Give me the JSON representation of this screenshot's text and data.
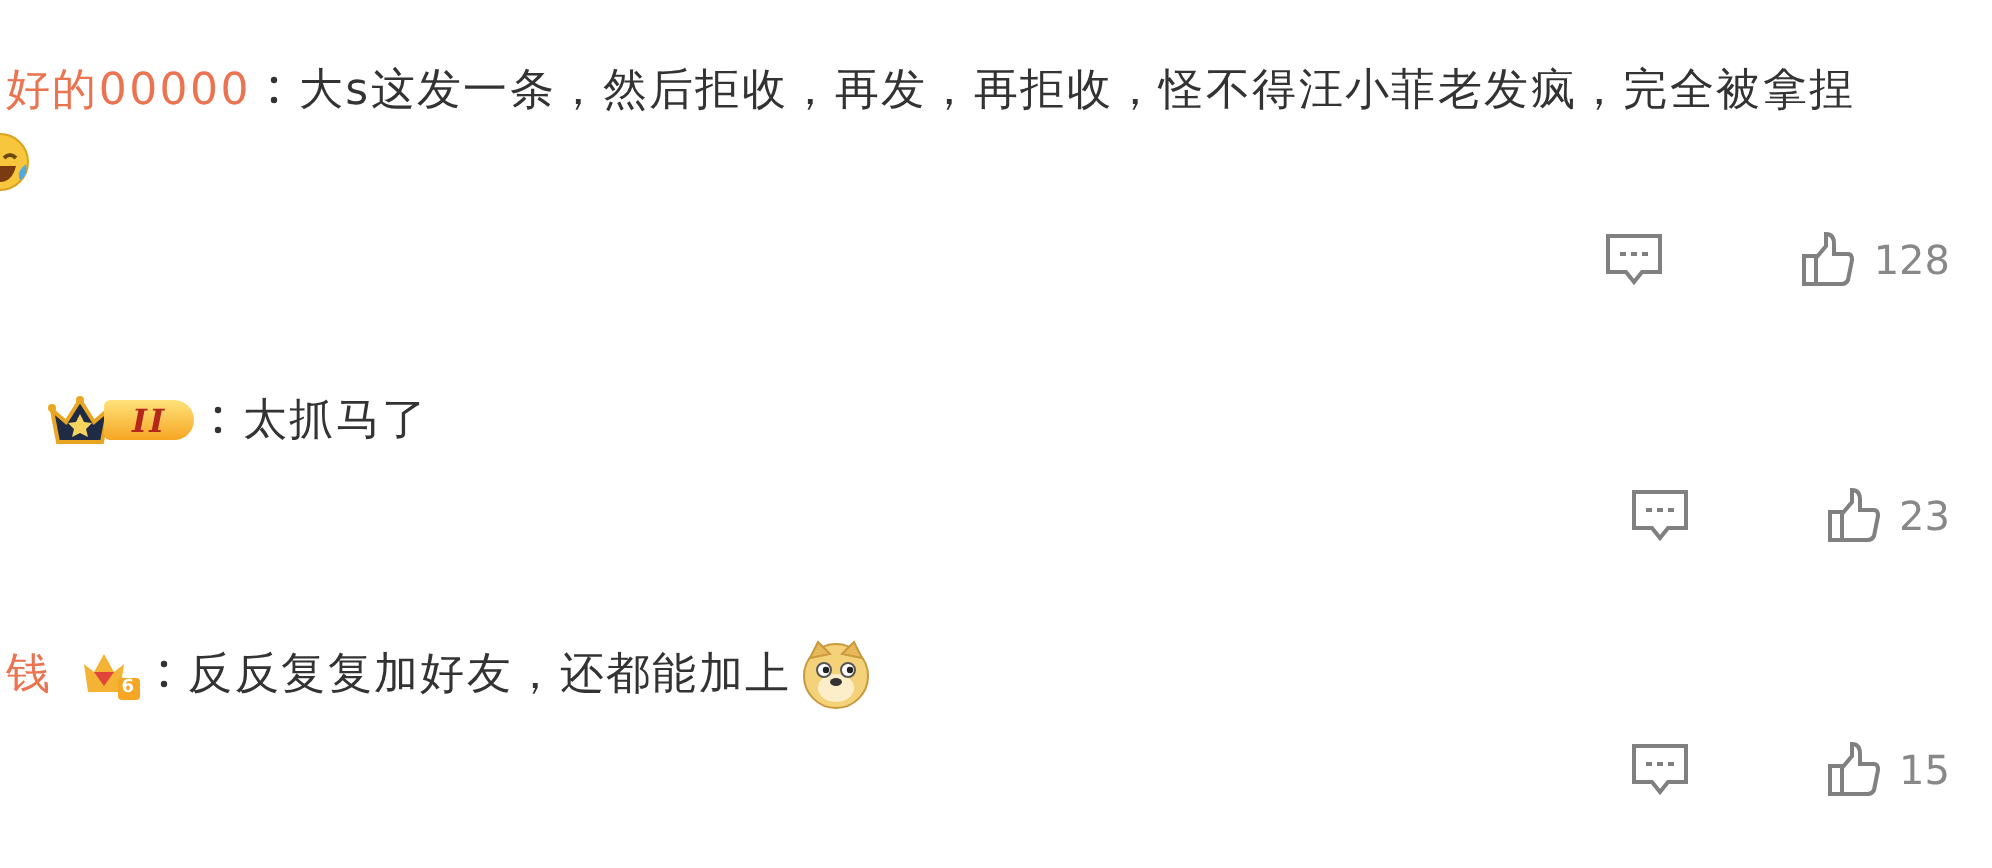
{
  "comments": [
    {
      "user": "好的00000",
      "text": "大s这发一条，然后拒收，再发，再拒收，怪不得汪小菲老发疯，完全被拿捏",
      "emoji_below": {
        "kind": "laugh-cry"
      },
      "likes": "128"
    },
    {
      "badge": {
        "kind": "crown-level",
        "label": "II"
      },
      "text": "太抓马了",
      "likes": "23"
    },
    {
      "user": "钱",
      "badge": {
        "kind": "vip",
        "label": "6"
      },
      "text": "反反复复加好友，还都能加上",
      "emoji": {
        "kind": "doge"
      },
      "likes": "15"
    }
  ]
}
